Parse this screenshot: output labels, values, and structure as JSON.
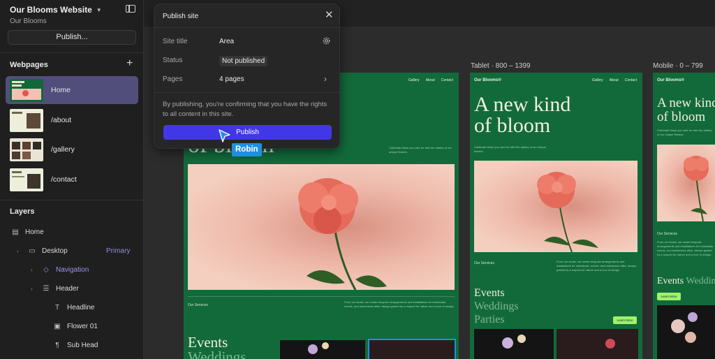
{
  "sidebar": {
    "site_name": "Our Blooms Website",
    "site_sub": "Our Blooms",
    "publish_label": "Publish...",
    "webpages_title": "Webpages",
    "pages": [
      {
        "label": "Home"
      },
      {
        "label": "/about"
      },
      {
        "label": "/gallery"
      },
      {
        "label": "/contact"
      }
    ],
    "layers_title": "Layers",
    "layers": [
      {
        "label": "Home",
        "icon": "page-icon"
      },
      {
        "label": "Desktop",
        "icon": "desktop-icon",
        "tag": "Primary"
      },
      {
        "label": "Navigation",
        "icon": "component-icon"
      },
      {
        "label": "Header",
        "icon": "stack-icon"
      },
      {
        "label": "Headline",
        "icon": "text-icon",
        "glyph": "T"
      },
      {
        "label": "Flower 01",
        "icon": "image-icon"
      },
      {
        "label": "Sub Head",
        "icon": "text-block-icon"
      }
    ],
    "accent": "#524e7c",
    "primary_color": "#8f8ce0"
  },
  "modal": {
    "title": "Publish site",
    "site_title_label": "Site title",
    "site_title_value": "Area",
    "status_label": "Status",
    "status_value": "Not published",
    "pages_label": "Pages",
    "pages_value": "4 pages",
    "note": "By publishing, you're confirming that you have the rights to all content in this site.",
    "publish_label": "Publish",
    "publish_color": "#4137e6"
  },
  "collaborator": {
    "name": "Robin",
    "color": "#1f8fe0"
  },
  "canvas": {
    "tablet_label": "Tablet · 800 – 1399",
    "mobile_label": "Mobile · 0 – 799",
    "brand": "Our Blooms®",
    "nav_links": [
      "Gallery",
      "About",
      "Contact"
    ],
    "hero_heading_line1": "A new kind",
    "hero_heading_line2": "of bloom",
    "tagline": "Celebrate those you care for with the artistry of our unique flowers.",
    "services_label": "Our Services",
    "services_text": "From our studio, we create bespoke arrangements and installations for individuals, events, and businesses alike, always guided by a respect for nature and a love of design.",
    "events": [
      "Events",
      "Weddings",
      "Parties"
    ],
    "learn_more": "Learn More",
    "frame_green": "#126a3a"
  }
}
